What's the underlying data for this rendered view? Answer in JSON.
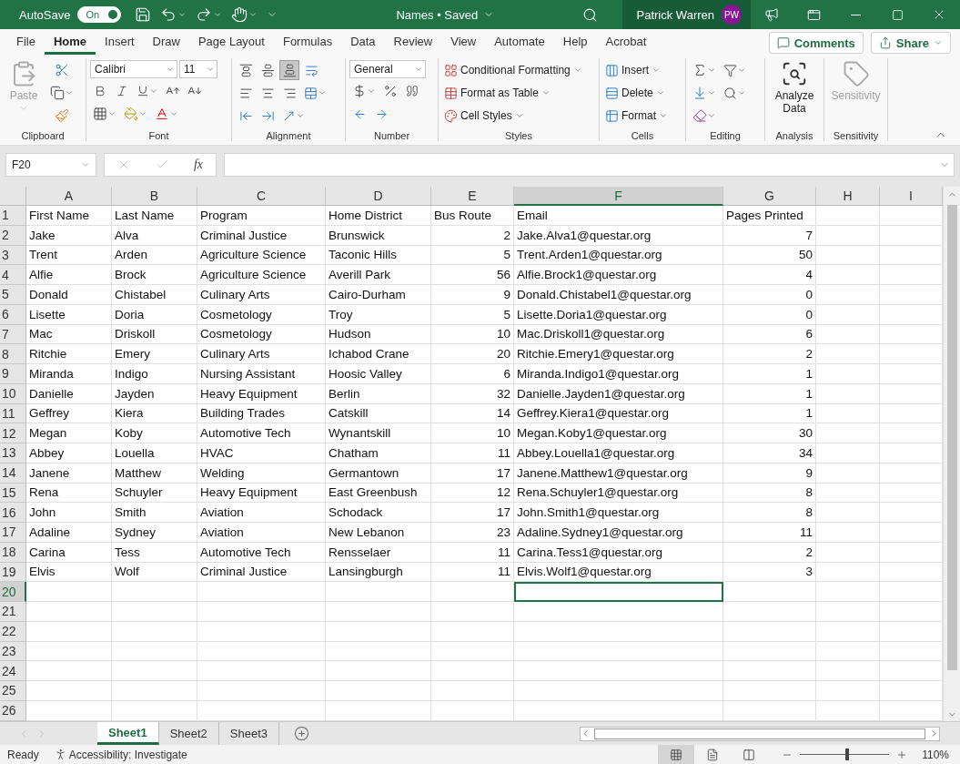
{
  "title_bar": {
    "autosave_label": "AutoSave",
    "autosave_toggle": {
      "label": "On",
      "on": true
    },
    "document_title": "Names • Saved",
    "user_name": "Patrick Warren",
    "user_initials": "PW"
  },
  "menu_tabs": [
    {
      "label": "File",
      "selected": false
    },
    {
      "label": "Home",
      "selected": true
    },
    {
      "label": "Insert",
      "selected": false
    },
    {
      "label": "Draw",
      "selected": false
    },
    {
      "label": "Page Layout",
      "selected": false
    },
    {
      "label": "Formulas",
      "selected": false
    },
    {
      "label": "Data",
      "selected": false
    },
    {
      "label": "Review",
      "selected": false
    },
    {
      "label": "View",
      "selected": false
    },
    {
      "label": "Automate",
      "selected": false
    },
    {
      "label": "Help",
      "selected": false
    },
    {
      "label": "Acrobat",
      "selected": false
    }
  ],
  "comments_button": "Comments",
  "share_button": "Share",
  "ribbon": {
    "clipboard": {
      "label": "Clipboard",
      "paste": {
        "label": "Paste",
        "disabled": true
      }
    },
    "font": {
      "label": "Font",
      "font_name": "Calibri",
      "font_size": "11"
    },
    "alignment": {
      "label": "Alignment",
      "vertical_align": [
        {
          "selected": false
        },
        {
          "selected": false
        },
        {
          "selected": true
        }
      ]
    },
    "number": {
      "label": "Number",
      "format": "General"
    },
    "styles": {
      "label": "Styles",
      "buttons": [
        "Conditional Formatting",
        "Format as Table",
        "Cell Styles"
      ]
    },
    "cells": {
      "label": "Cells",
      "buttons": [
        "Insert",
        "Delete",
        "Format"
      ]
    },
    "editing": {
      "label": "Editing"
    },
    "analysis": {
      "label": "Analysis",
      "button": {
        "label": "Analyze Data",
        "disabled": false
      }
    },
    "sensitivity": {
      "label": "Sensitivity",
      "button": {
        "label": "Sensitivity",
        "disabled": true
      }
    }
  },
  "formula_bar": {
    "name_box": "F20",
    "function_label": "fx"
  },
  "grid": {
    "columns": [
      {
        "label": "A",
        "kind": "text",
        "selected": false
      },
      {
        "label": "B",
        "kind": "text",
        "selected": false
      },
      {
        "label": "C",
        "kind": "text",
        "selected": false
      },
      {
        "label": "D",
        "kind": "text",
        "selected": false
      },
      {
        "label": "E",
        "kind": "number",
        "selected": false
      },
      {
        "label": "F",
        "kind": "text",
        "selected": true
      },
      {
        "label": "G",
        "kind": "number",
        "selected": false
      },
      {
        "label": "H",
        "kind": "text",
        "selected": false
      },
      {
        "label": "I",
        "kind": "text",
        "selected": false
      }
    ],
    "rows": [
      {
        "number": "1",
        "selected": false,
        "cells": [
          "First Name",
          "Last Name",
          "Program",
          "Home District",
          "Bus Route",
          "Email",
          "Pages Printed"
        ],
        "header": true
      },
      {
        "number": "2",
        "selected": false,
        "cells": [
          "Jake",
          "Alva",
          "Criminal Justice",
          "Brunswick",
          "2",
          "Jake.Alva1@questar.org",
          "7"
        ]
      },
      {
        "number": "3",
        "selected": false,
        "cells": [
          "Trent",
          "Arden",
          "Agriculture Science",
          "Taconic Hills",
          "5",
          "Trent.Arden1@questar.org",
          "50"
        ]
      },
      {
        "number": "4",
        "selected": false,
        "cells": [
          "Alfie",
          "Brock",
          "Agriculture Science",
          "Averill Park",
          "56",
          "Alfie.Brock1@questar.org",
          "4"
        ]
      },
      {
        "number": "5",
        "selected": false,
        "cells": [
          "Donald",
          "Chistabel",
          "Culinary Arts",
          "Cairo-Durham",
          "9",
          "Donald.Chistabel1@questar.org",
          "0"
        ]
      },
      {
        "number": "6",
        "selected": false,
        "cells": [
          "Lisette",
          "Doria",
          "Cosmetology",
          "Troy",
          "5",
          "Lisette.Doria1@questar.org",
          "0"
        ]
      },
      {
        "number": "7",
        "selected": false,
        "cells": [
          "Mac",
          "Driskoll",
          "Cosmetology",
          "Hudson",
          "10",
          "Mac.Driskoll1@questar.org",
          "6"
        ]
      },
      {
        "number": "8",
        "selected": false,
        "cells": [
          "Ritchie",
          "Emery",
          "Culinary Arts",
          "Ichabod Crane",
          "20",
          "Ritchie.Emery1@questar.org",
          "2"
        ]
      },
      {
        "number": "9",
        "selected": false,
        "cells": [
          "Miranda",
          "Indigo",
          "Nursing Assistant",
          "Hoosic Valley",
          "6",
          "Miranda.Indigo1@questar.org",
          "1"
        ]
      },
      {
        "number": "10",
        "selected": false,
        "cells": [
          "Danielle",
          "Jayden",
          "Heavy Equipment",
          "Berlin",
          "32",
          "Danielle.Jayden1@questar.org",
          "1"
        ]
      },
      {
        "number": "11",
        "selected": false,
        "cells": [
          "Geffrey",
          "Kiera",
          "Building Trades",
          "Catskill",
          "14",
          "Geffrey.Kiera1@questar.org",
          "1"
        ]
      },
      {
        "number": "12",
        "selected": false,
        "cells": [
          "Megan",
          "Koby",
          "Automotive Tech",
          "Wynantskill",
          "10",
          "Megan.Koby1@questar.org",
          "30"
        ]
      },
      {
        "number": "13",
        "selected": false,
        "cells": [
          "Abbey",
          "Louella",
          "HVAC",
          "Chatham",
          "11",
          "Abbey.Louella1@questar.org",
          "34"
        ]
      },
      {
        "number": "14",
        "selected": false,
        "cells": [
          "Janene",
          "Matthew",
          "Welding",
          "Germantown",
          "17",
          "Janene.Matthew1@questar.org",
          "9"
        ]
      },
      {
        "number": "15",
        "selected": false,
        "cells": [
          "Rena",
          "Schuyler",
          "Heavy Equipment",
          "East Greenbush",
          "12",
          "Rena.Schuyler1@questar.org",
          "8"
        ]
      },
      {
        "number": "16",
        "selected": false,
        "cells": [
          "John",
          "Smith",
          "Aviation",
          "Schodack",
          "17",
          "John.Smith1@questar.org",
          "8"
        ]
      },
      {
        "number": "17",
        "selected": false,
        "cells": [
          "Adaline",
          "Sydney",
          "Aviation",
          "New Lebanon",
          "23",
          "Adaline.Sydney1@questar.org",
          "11"
        ]
      },
      {
        "number": "18",
        "selected": false,
        "cells": [
          "Carina",
          "Tess",
          "Automotive Tech",
          "Rensselaer",
          "11",
          "Carina.Tess1@questar.org",
          "2"
        ]
      },
      {
        "number": "19",
        "selected": false,
        "cells": [
          "Elvis",
          "Wolf",
          "Criminal Justice",
          "Lansingburgh",
          "11",
          "Elvis.Wolf1@questar.org",
          "3"
        ]
      },
      {
        "number": "20",
        "selected": true
      },
      {
        "number": "21",
        "selected": false
      },
      {
        "number": "22",
        "selected": false
      },
      {
        "number": "23",
        "selected": false
      },
      {
        "number": "24",
        "selected": false
      },
      {
        "number": "25",
        "selected": false
      },
      {
        "number": "26",
        "selected": false
      }
    ]
  },
  "sheet_tabs": [
    {
      "label": "Sheet1",
      "selected": true
    },
    {
      "label": "Sheet2",
      "selected": false
    },
    {
      "label": "Sheet3",
      "selected": false
    }
  ],
  "status_bar": {
    "status": "Ready",
    "accessibility": "Accessibility: Investigate",
    "view_buttons": [
      {
        "selected": true
      },
      {
        "selected": false
      },
      {
        "selected": false
      }
    ],
    "zoom": {
      "level": 0.53
    },
    "zoom_label": "110%"
  }
}
